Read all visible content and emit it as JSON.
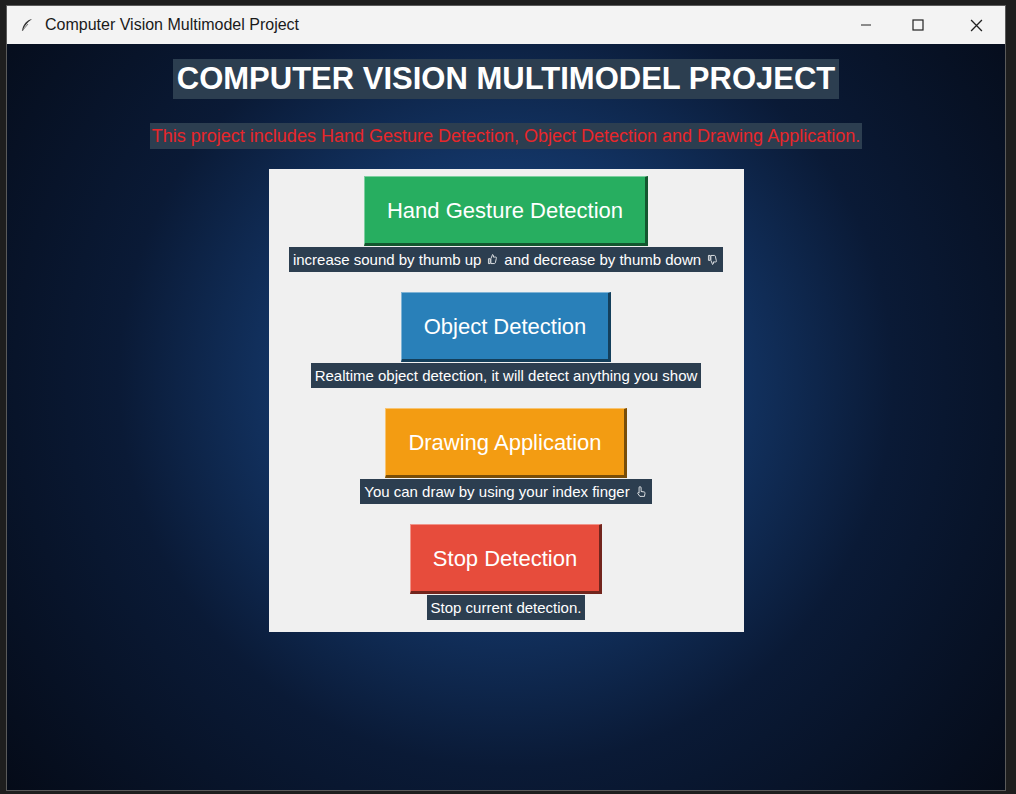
{
  "window": {
    "title": "Computer Vision Multimodel Project"
  },
  "heading": "COMPUTER VISION MULTIMODEL PROJECT",
  "subtitle": "This project includes Hand Gesture Detection, Object Detection and Drawing Application.",
  "actions": [
    {
      "label": "Hand Gesture Detection",
      "color": "#27ae60",
      "description": [
        {
          "kind": "text",
          "text": "increase sound by thumb up"
        },
        {
          "kind": "thumbs-up"
        },
        {
          "kind": "text",
          "text": "and decrease by thumb down"
        },
        {
          "kind": "thumbs-down"
        }
      ]
    },
    {
      "label": "Object Detection",
      "color": "#2980b9",
      "description": [
        {
          "kind": "text",
          "text": "Realtime object detection, it will detect anything you show"
        }
      ]
    },
    {
      "label": "Drawing Application",
      "color": "#f39c12",
      "description": [
        {
          "kind": "text",
          "text": "You can draw by using your index finger"
        },
        {
          "kind": "pointer"
        }
      ]
    },
    {
      "label": "Stop Detection",
      "color": "#e74c3c",
      "description": [
        {
          "kind": "text",
          "text": "Stop current detection."
        }
      ]
    }
  ]
}
